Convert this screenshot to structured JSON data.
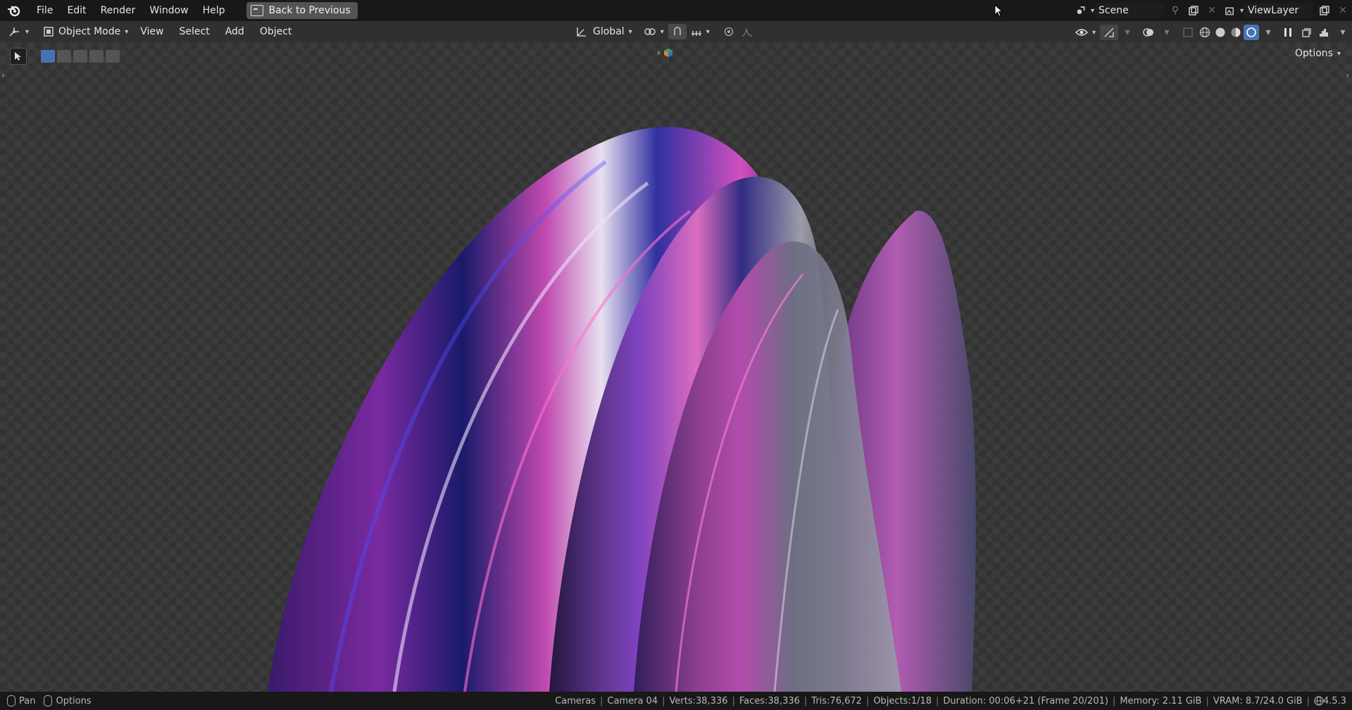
{
  "topbar": {
    "menus": [
      "File",
      "Edit",
      "Render",
      "Window",
      "Help"
    ],
    "back_button": "Back to Previous",
    "scene": "Scene",
    "view_layer": "ViewLayer"
  },
  "header": {
    "mode": "Object Mode",
    "menus": [
      "View",
      "Select",
      "Add",
      "Object"
    ],
    "transform_orientation": "Global",
    "options_label": "Options"
  },
  "statusbar": {
    "left_pan": "Pan",
    "left_options": "Options",
    "stats": [
      "Cameras",
      "Camera 04",
      "Verts:38,336",
      "Faces:38,336",
      "Tris:76,672",
      "Objects:1/18",
      "Duration: 00:06+21 (Frame 20/201)",
      "Memory: 2.11 GiB",
      "VRAM: 8.7/24.0 GiB"
    ],
    "version": "4.5.3"
  },
  "colors": {
    "accent_blue": "#4772b3",
    "tool_active": "#e8a437"
  }
}
